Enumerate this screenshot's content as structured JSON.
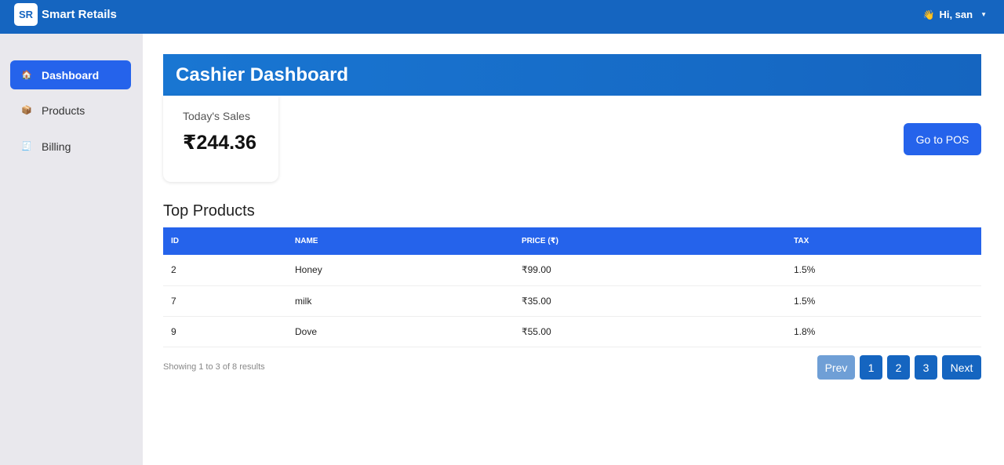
{
  "header": {
    "logo": "SR",
    "brand": "Smart Retails",
    "wave": "👋",
    "user": "Hi,  san",
    "caret": "▼"
  },
  "sidebar": {
    "items": [
      {
        "icon": "🏠",
        "label": "Dashboard",
        "active": true
      },
      {
        "icon": "📦",
        "label": "Products",
        "active": false
      },
      {
        "icon": "🧾",
        "label": "Billing",
        "active": false
      }
    ]
  },
  "main": {
    "title": "Cashier Dashboard",
    "sales_card": {
      "label": "Today's Sales",
      "value": "₹244.36"
    },
    "pos_button": "Go to POS",
    "section_title": "Top Products",
    "table": {
      "headers": [
        "ID",
        "NAME",
        "PRICE (₹)",
        "TAX"
      ],
      "rows": [
        [
          "2",
          "Honey",
          "₹99.00",
          "1.5%"
        ],
        [
          "7",
          "milk",
          "₹35.00",
          "1.5%"
        ],
        [
          "9",
          "Dove",
          "₹55.00",
          "1.8%"
        ]
      ]
    },
    "footer_info": "Showing 1 to 3 of 8 results",
    "pagination": {
      "prev": "Prev",
      "pages": [
        "1",
        "2",
        "3"
      ],
      "next": "Next"
    }
  },
  "colors": {
    "topbar": "#1565c0",
    "accent": "#2563eb",
    "sidebar_bg": "#e9e8ed"
  }
}
